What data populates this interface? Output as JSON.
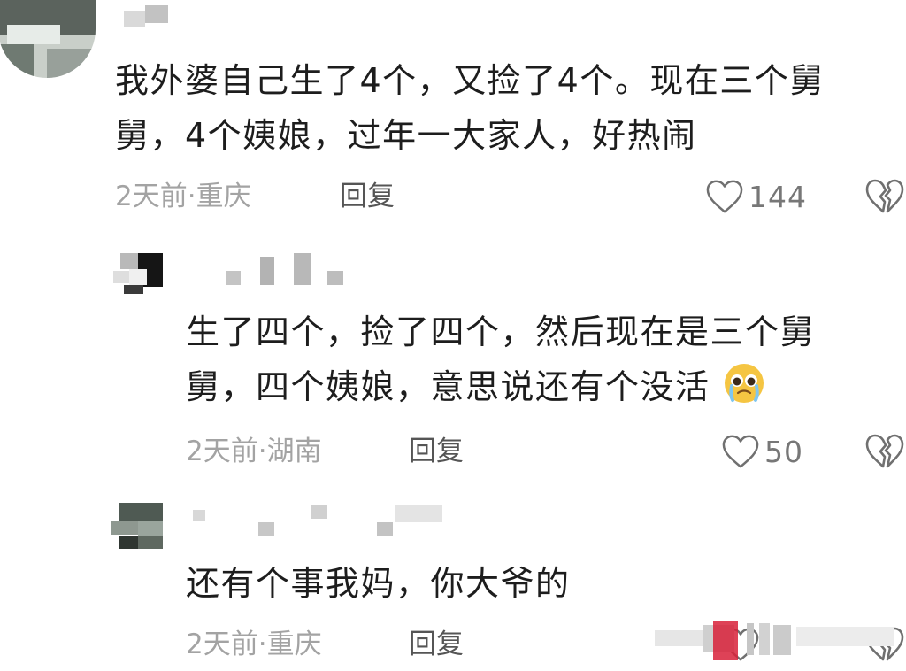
{
  "comments": [
    {
      "text_lines": [
        "我外婆自己生了4个，又捡了4个。现在三个舅",
        "舅，4个姨娘，过年一大家人，好热闹"
      ],
      "time": "2天前",
      "location": "重庆",
      "reply_label": "回复",
      "likes": "144"
    },
    {
      "text_lines": [
        "生了四个，捡了四个，然后现在是三个舅",
        "舅，四个姨娘，意思说还有个没活"
      ],
      "emoji": "pleading-crying-face-emoji",
      "time": "2天前",
      "location": "湖南",
      "reply_label": "回复",
      "likes": "50"
    },
    {
      "text_lines": [
        "还有个事我妈，你大爷的"
      ],
      "time": "2天前",
      "location": "重庆",
      "reply_label": "回复",
      "likes": ""
    }
  ],
  "meta_separator": "·",
  "icons": {
    "like": "heart-outline-icon",
    "dislike": "broken-heart-icon"
  },
  "colors": {
    "text": "#1d1d1d",
    "meta": "#a3a3a3",
    "icon": "#707070",
    "watermark_red": "#d8213a"
  }
}
